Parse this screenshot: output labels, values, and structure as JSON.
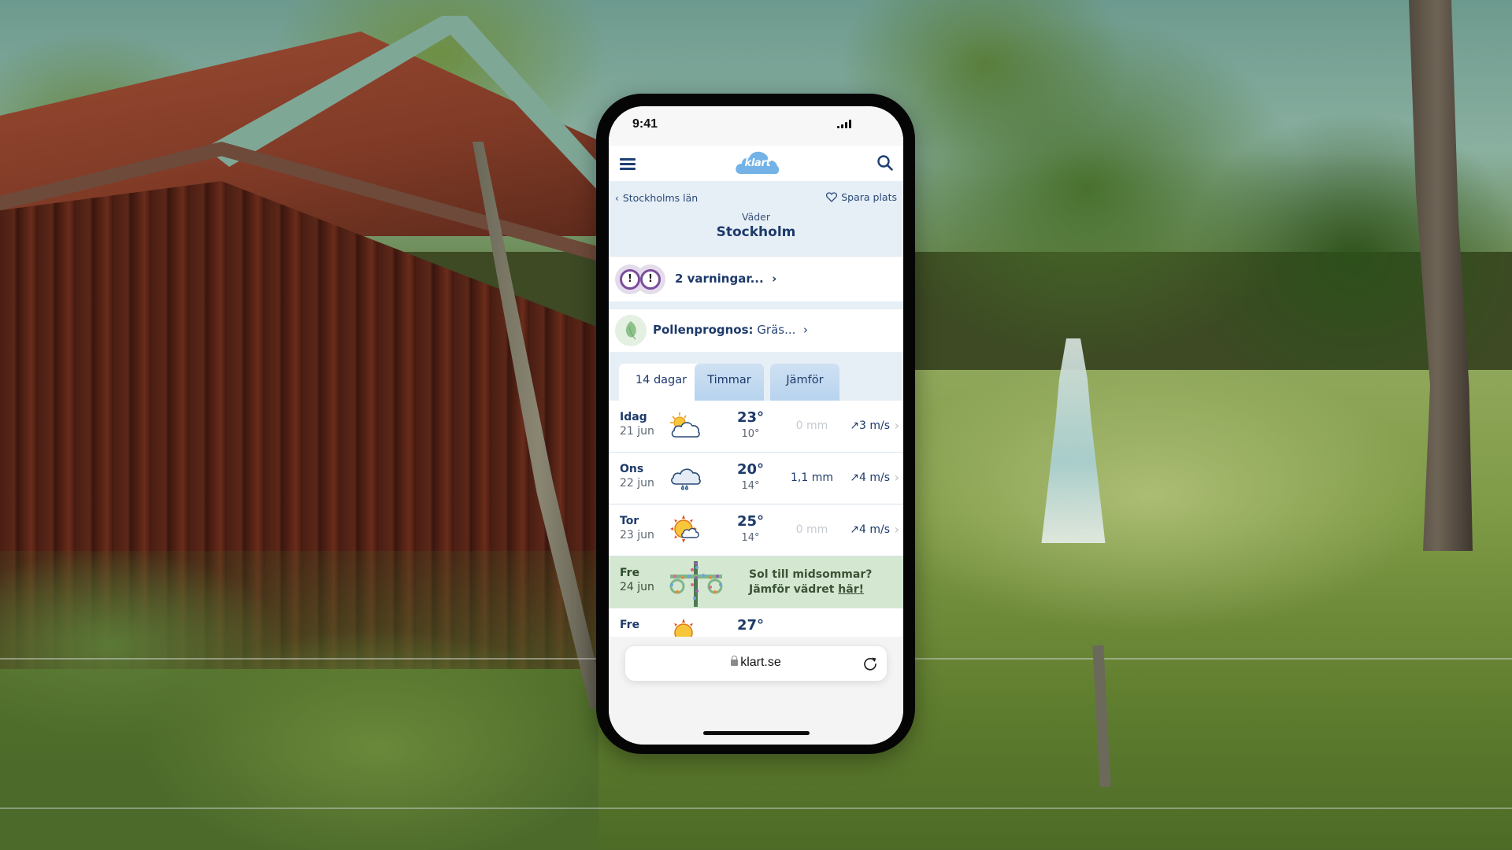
{
  "status_bar": {
    "time": "9:41",
    "signal_icon": "cellular-signal-icon"
  },
  "nav": {
    "menu_icon": "hamburger-menu-icon",
    "logo_text": "klart",
    "search_icon": "search-icon"
  },
  "subheader": {
    "back_label": "Stockholms län",
    "save_label": "Spara plats",
    "save_icon": "heart-icon",
    "section_label": "Väder",
    "city": "Stockholm"
  },
  "alerts": {
    "warnings_label": "2 varningar...",
    "warnings_icon": "warning-exclamation-icon",
    "pollen_label": "Pollenprognos:",
    "pollen_value": "Gräs...",
    "pollen_icon": "leaf-icon"
  },
  "tabs": [
    {
      "label": "14 dagar",
      "active": true
    },
    {
      "label": "Timmar",
      "active": false
    },
    {
      "label": "Jämför",
      "active": false
    }
  ],
  "forecast": [
    {
      "day": "Idag",
      "date": "21 jun",
      "icon": "partly-cloudy-icon",
      "max": "23°",
      "min": "10°",
      "precip": "0 mm",
      "wind": "3 m/s"
    },
    {
      "day": "Ons",
      "date": "22 jun",
      "icon": "rain-cloud-icon",
      "max": "20°",
      "min": "14°",
      "precip": "1,1 mm",
      "wind": "4 m/s"
    },
    {
      "day": "Tor",
      "date": "23 jun",
      "icon": "sun-small-cloud-icon",
      "max": "25°",
      "min": "14°",
      "precip": "0 mm",
      "wind": "4 m/s"
    }
  ],
  "promo": {
    "day": "Fre",
    "date": "24 jun",
    "icon": "maypole-icon",
    "line1": "Sol till midsommar?",
    "line2_prefix": "Jämför vädret ",
    "line2_link": "här!"
  },
  "partial_row": {
    "day": "Fre",
    "max": "27°",
    "icon": "sun-icon"
  },
  "browser": {
    "url": "klart.se",
    "lock_icon": "lock-icon",
    "reload_icon": "reload-icon"
  },
  "colors": {
    "brand_blue": "#1d3a6a",
    "logo_blue": "#72b2e6",
    "subheader_bg": "#e6eef6",
    "warning_purple": "#7a4e9b",
    "promo_green": "#d4e8d1"
  }
}
